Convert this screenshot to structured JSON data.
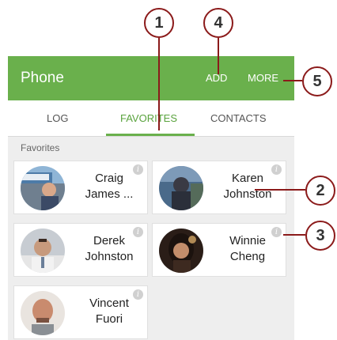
{
  "appbar": {
    "title": "Phone",
    "add_label": "ADD",
    "more_label": "MORE"
  },
  "tabs": [
    {
      "label": "LOG"
    },
    {
      "label": "FAVORITES",
      "selected": true
    },
    {
      "label": "CONTACTS"
    }
  ],
  "section_label": "Favorites",
  "contacts": [
    {
      "line1": "Craig",
      "line2": "James ..."
    },
    {
      "line1": "Karen",
      "line2": "Johnston"
    },
    {
      "line1": "Derek",
      "line2": "Johnston"
    },
    {
      "line1": "Winnie",
      "line2": "Cheng"
    },
    {
      "line1": "Vincent",
      "line2": "Fuori"
    }
  ],
  "info_glyph": "i",
  "callouts": [
    "1",
    "4",
    "5",
    "2",
    "3"
  ],
  "colors": {
    "accent": "#6ab04c",
    "callout_border": "#8b1a1a"
  }
}
